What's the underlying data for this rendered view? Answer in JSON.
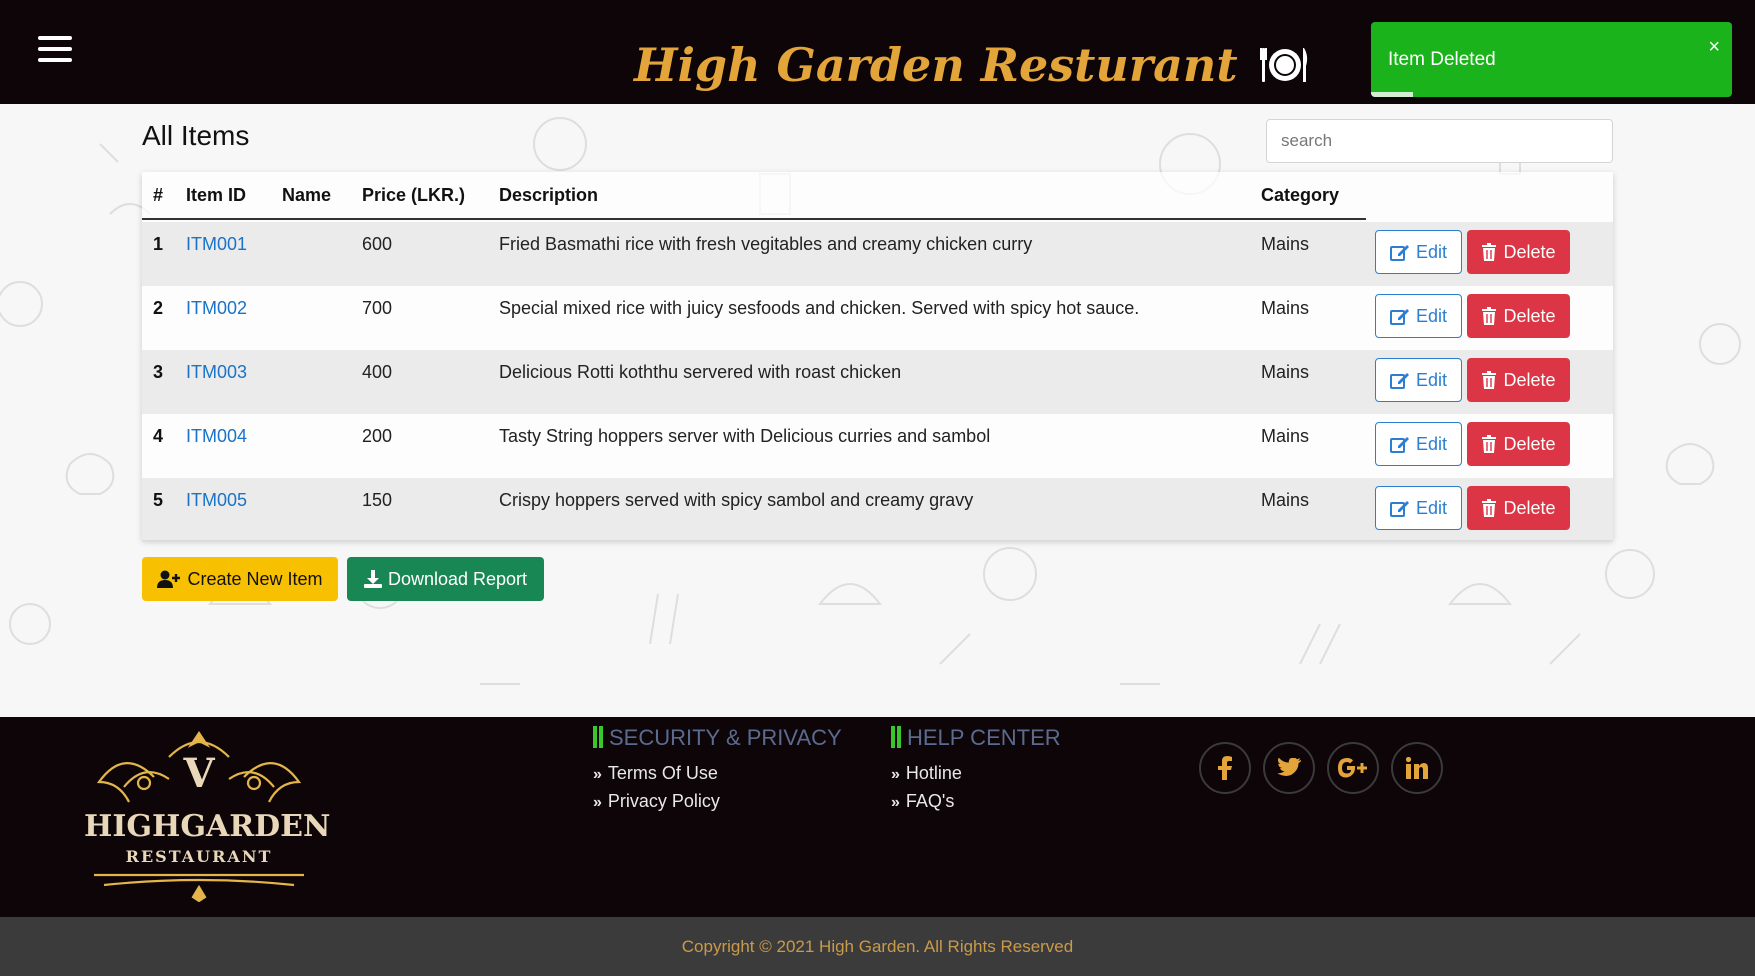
{
  "header": {
    "title": "High Garden Resturant"
  },
  "toast": {
    "message": "Item Deleted",
    "close": "×"
  },
  "main": {
    "title": "All Items",
    "search_placeholder": "search",
    "table": {
      "headers": [
        "#",
        "Item ID",
        "Name",
        "Price (LKR.)",
        "Description",
        "Category"
      ],
      "rows": [
        {
          "num": "1",
          "id": "ITM001",
          "name": "",
          "price": "600",
          "desc": "Fried Basmathi rice with fresh vegitables and creamy chicken curry",
          "category": "Mains"
        },
        {
          "num": "2",
          "id": "ITM002",
          "name": "",
          "price": "700",
          "desc": "Special mixed rice with juicy sesfoods and chicken. Served with spicy hot sauce.",
          "category": "Mains"
        },
        {
          "num": "3",
          "id": "ITM003",
          "name": "",
          "price": "400",
          "desc": "Delicious Rotti koththu servered with roast chicken",
          "category": "Mains"
        },
        {
          "num": "4",
          "id": "ITM004",
          "name": "",
          "price": "200",
          "desc": "Tasty String hoppers server with Delicious curries and sambol",
          "category": "Mains"
        },
        {
          "num": "5",
          "id": "ITM005",
          "name": "",
          "price": "150",
          "desc": "Crispy hoppers served with spicy sambol and creamy gravy",
          "category": "Mains"
        }
      ],
      "edit_label": "Edit",
      "delete_label": "Delete"
    },
    "create_label": "Create New Item",
    "report_label": "Download Report"
  },
  "footer": {
    "logo_line1": "HIGHGARDEN",
    "logo_line2": "RESTAURANT",
    "logo_letter": "V",
    "security": {
      "title": "SECURITY & PRIVACY",
      "links": [
        "Terms Of Use",
        "Privacy Policy"
      ]
    },
    "help": {
      "title": "HELP CENTER",
      "links": [
        "Hotline",
        "FAQ's"
      ]
    },
    "social": [
      "facebook-icon",
      "twitter-icon",
      "google-plus-icon",
      "linkedin-icon"
    ],
    "copyright": "Copyright © 2021 High Garden. All Rights Reserved"
  },
  "colors": {
    "header_bg": "#0d0508",
    "brand_gold": "#e3a43a",
    "toast_green": "#1bb31b",
    "edit_blue": "#2a7fd4",
    "delete_red": "#dc3545",
    "create_yellow": "#f7c000",
    "report_green": "#198754",
    "footer_accent": "#38c82a"
  }
}
